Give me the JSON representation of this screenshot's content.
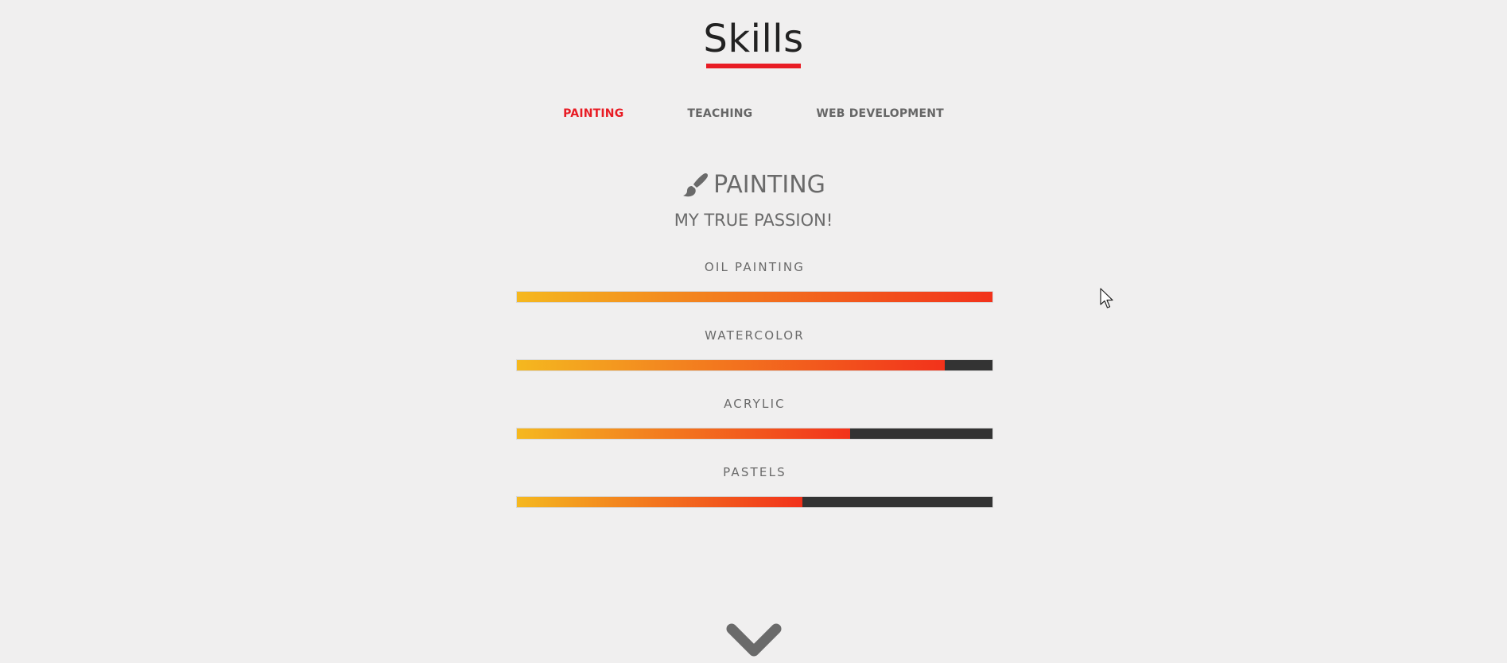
{
  "header": {
    "title": "Skills",
    "accent_color": "#e81c24"
  },
  "tabs": [
    {
      "label": "PAINTING",
      "active": true
    },
    {
      "label": "TEACHING",
      "active": false
    },
    {
      "label": "WEB DEVELOPMENT",
      "active": false
    }
  ],
  "section": {
    "icon": "paintbrush-icon",
    "heading": "PAINTING",
    "subtitle": "MY TRUE PASSION!"
  },
  "skills": [
    {
      "label": "OIL PAINTING",
      "level": 1.0
    },
    {
      "label": "WATERCOLOR",
      "level": 0.9
    },
    {
      "label": "ACRYLIC",
      "level": 0.7
    },
    {
      "label": "PASTELS",
      "level": 0.6
    }
  ],
  "colors": {
    "bar_gradient_start": "#f5b81f",
    "bar_gradient_end": "#f2321b",
    "bar_track": "#333333",
    "text_muted": "#6a6a6a"
  },
  "scroll_icon": "chevron-down-icon"
}
